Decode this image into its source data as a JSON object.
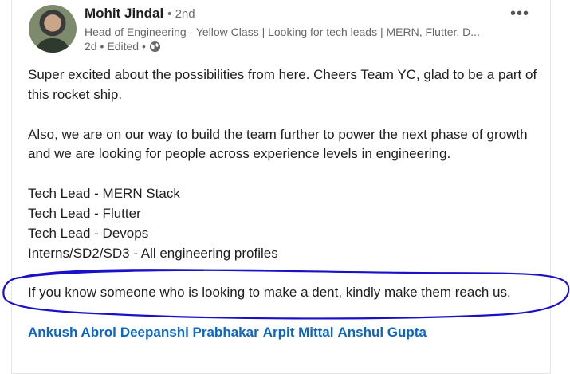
{
  "post": {
    "author": {
      "name": "Mohit Jindal",
      "degree": "• 2nd"
    },
    "headline": "Head of Engineering - Yellow Class | Looking for tech leads | MERN, Flutter, D...",
    "meta": {
      "time": "2d •",
      "edited": "Edited •"
    },
    "more_label": "•••",
    "paragraphs": [
      "Super excited about the possibilities from here. Cheers Team YC, glad to be a part of this rocket ship.",
      "Also, we are on our way to build the team further to power the next phase of growth and we are looking for people across experience levels in engineering."
    ],
    "roles": [
      "Tech Lead - MERN Stack",
      "Tech Lead - Flutter",
      "Tech Lead - Devops",
      "Interns/SD2/SD3 - All engineering profiles"
    ],
    "highlight_text": "If you know someone who is looking to make a dent, kindly make them reach us.",
    "mentions": [
      "Ankush Abrol",
      "Deepanshi Prabhakar",
      "Arpit Mittal",
      "Anshul Gupta"
    ]
  },
  "colors": {
    "link": "#0a66c2",
    "annotation": "#1a10c8"
  },
  "icons": {
    "visibility": "globe-icon",
    "overflow": "more-icon"
  }
}
